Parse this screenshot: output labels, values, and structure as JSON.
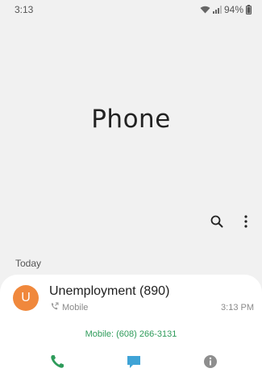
{
  "status": {
    "time": "3:13",
    "battery": "94%",
    "icons": [
      "wifi-icon",
      "signal-icon",
      "battery-icon"
    ]
  },
  "header": {
    "title": "Phone"
  },
  "toolbar": {
    "icons": [
      "search-icon",
      "more-options-icon"
    ]
  },
  "section": {
    "label": "Today"
  },
  "recent_call": {
    "avatar_letter": "U",
    "avatar_color": "#f0883c",
    "name": "Unemployment (890)",
    "type_label": "Mobile",
    "time": "3:13 PM",
    "number_line": "Mobile: (608) 266-3131",
    "actions": [
      "call-icon",
      "message-icon",
      "info-icon"
    ]
  },
  "colors": {
    "background": "#f1f1f1",
    "card": "#ffffff",
    "call_green": "#2e9b5a",
    "message_blue": "#3fa3d6",
    "info_gray": "#8e8e8e"
  }
}
